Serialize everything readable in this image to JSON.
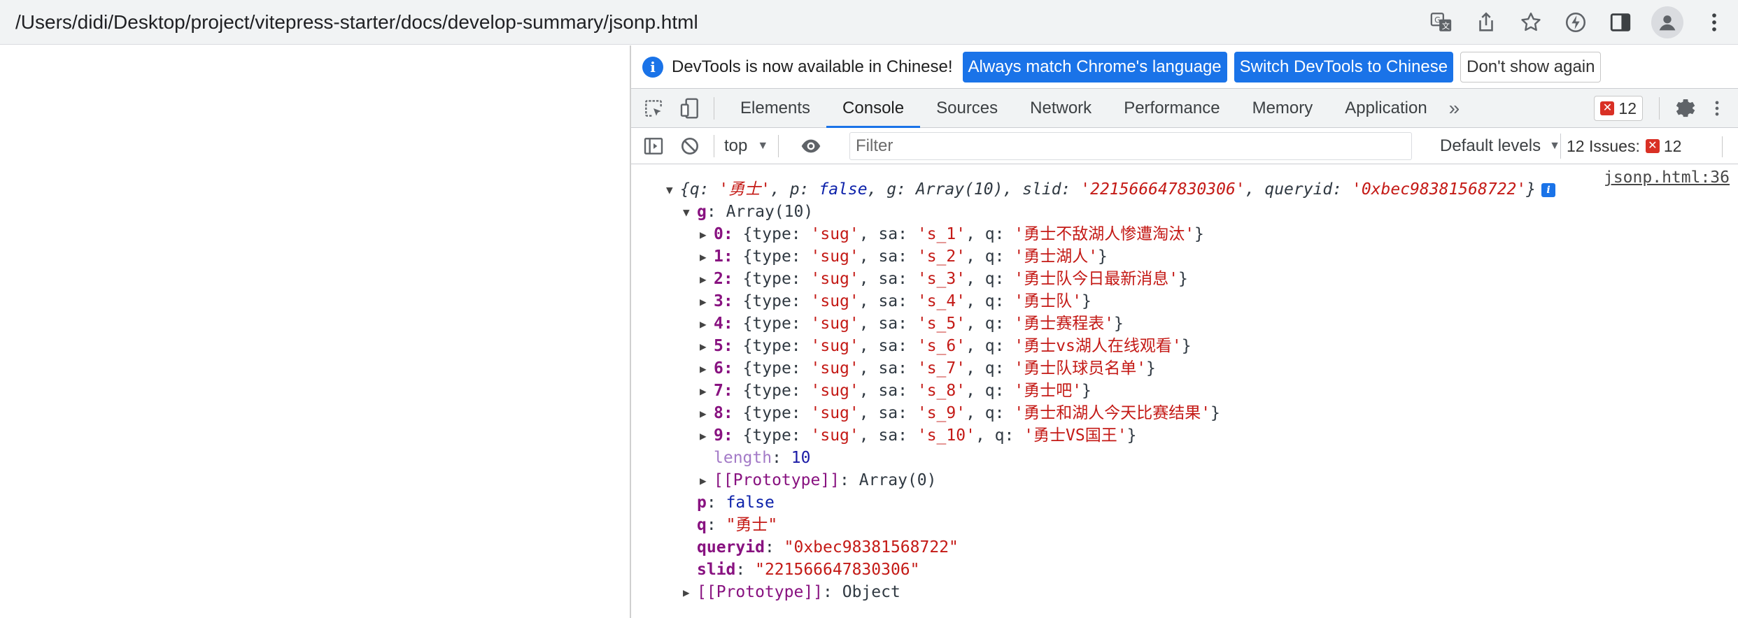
{
  "browser": {
    "url": "/Users/didi/Desktop/project/vitepress-starter/docs/develop-summary/jsonp.html"
  },
  "devtools": {
    "infobar": {
      "text": "DevTools is now available in Chinese!",
      "match_btn": "Always match Chrome's language",
      "switch_btn": "Switch DevTools to Chinese",
      "dismiss_btn": "Don't show again"
    },
    "tabs": [
      "Elements",
      "Console",
      "Sources",
      "Network",
      "Performance",
      "Memory",
      "Application"
    ],
    "active_tab": "Console",
    "more_tabs": "»",
    "error_count": "12",
    "toolbar": {
      "context": "top",
      "filter_placeholder": "Filter",
      "levels": "Default levels",
      "issues_label": "12 Issues:",
      "issues_count": "12"
    },
    "console": {
      "source_link": "jsonp.html:36",
      "summary": {
        "q": "'勇士'",
        "p": "false",
        "g": "Array(10)",
        "slid": "'221566647830306'",
        "queryid": "'0xbec98381568722'"
      },
      "g_label": "Array(10)",
      "items": [
        {
          "index": "0",
          "type": "'sug'",
          "sa": "'s_1'",
          "q": "'勇士不敌湖人惨遭淘汰'"
        },
        {
          "index": "1",
          "type": "'sug'",
          "sa": "'s_2'",
          "q": "'勇士湖人'"
        },
        {
          "index": "2",
          "type": "'sug'",
          "sa": "'s_3'",
          "q": "'勇士队今日最新消息'"
        },
        {
          "index": "3",
          "type": "'sug'",
          "sa": "'s_4'",
          "q": "'勇士队'"
        },
        {
          "index": "4",
          "type": "'sug'",
          "sa": "'s_5'",
          "q": "'勇士赛程表'"
        },
        {
          "index": "5",
          "type": "'sug'",
          "sa": "'s_6'",
          "q": "'勇士vs湖人在线观看'"
        },
        {
          "index": "6",
          "type": "'sug'",
          "sa": "'s_7'",
          "q": "'勇士队球员名单'"
        },
        {
          "index": "7",
          "type": "'sug'",
          "sa": "'s_8'",
          "q": "'勇士吧'"
        },
        {
          "index": "8",
          "type": "'sug'",
          "sa": "'s_9'",
          "q": "'勇士和湖人今天比赛结果'"
        },
        {
          "index": "9",
          "type": "'sug'",
          "sa": "'s_10'",
          "q": "'勇士VS国王'"
        }
      ],
      "length_value": "10",
      "array_proto": "Array(0)",
      "p_value": "false",
      "q_value": "\"勇士\"",
      "queryid_value": "\"0xbec98381568722\"",
      "slid_value": "\"221566647830306\"",
      "object_proto": "Object"
    }
  }
}
